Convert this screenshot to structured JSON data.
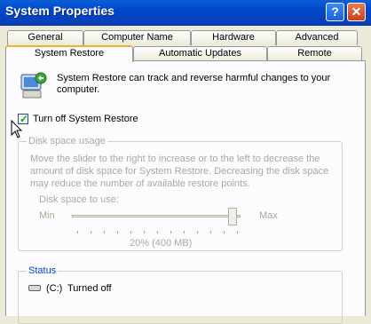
{
  "window": {
    "title": "System Properties",
    "help_label": "?",
    "close_label": "✕"
  },
  "tabs_top": [
    "General",
    "Computer Name",
    "Hardware",
    "Advanced"
  ],
  "tabs_bottom": [
    "System Restore",
    "Automatic Updates",
    "Remote"
  ],
  "selected_tab": "System Restore",
  "main": {
    "description": "System Restore can track and reverse harmful changes to your computer.",
    "checkbox_label": "Turn off System Restore",
    "checkbox_checked": true
  },
  "disk_space": {
    "group_title": "Disk space usage",
    "text": "Move the slider to the right to increase or to the left to decrease the amount of disk space for System Restore. Decreasing the disk space may reduce the number of available restore points.",
    "label": "Disk space to use:",
    "min_label": "Min",
    "max_label": "Max",
    "value_label": "20% (400 MB)",
    "slider_fraction": 0.95
  },
  "status": {
    "group_title": "Status",
    "drive": "(C:)",
    "drive_status": "Turned off"
  },
  "icons": [
    "system-restore-icon",
    "drive-icon",
    "mouse-pointer-icon"
  ]
}
